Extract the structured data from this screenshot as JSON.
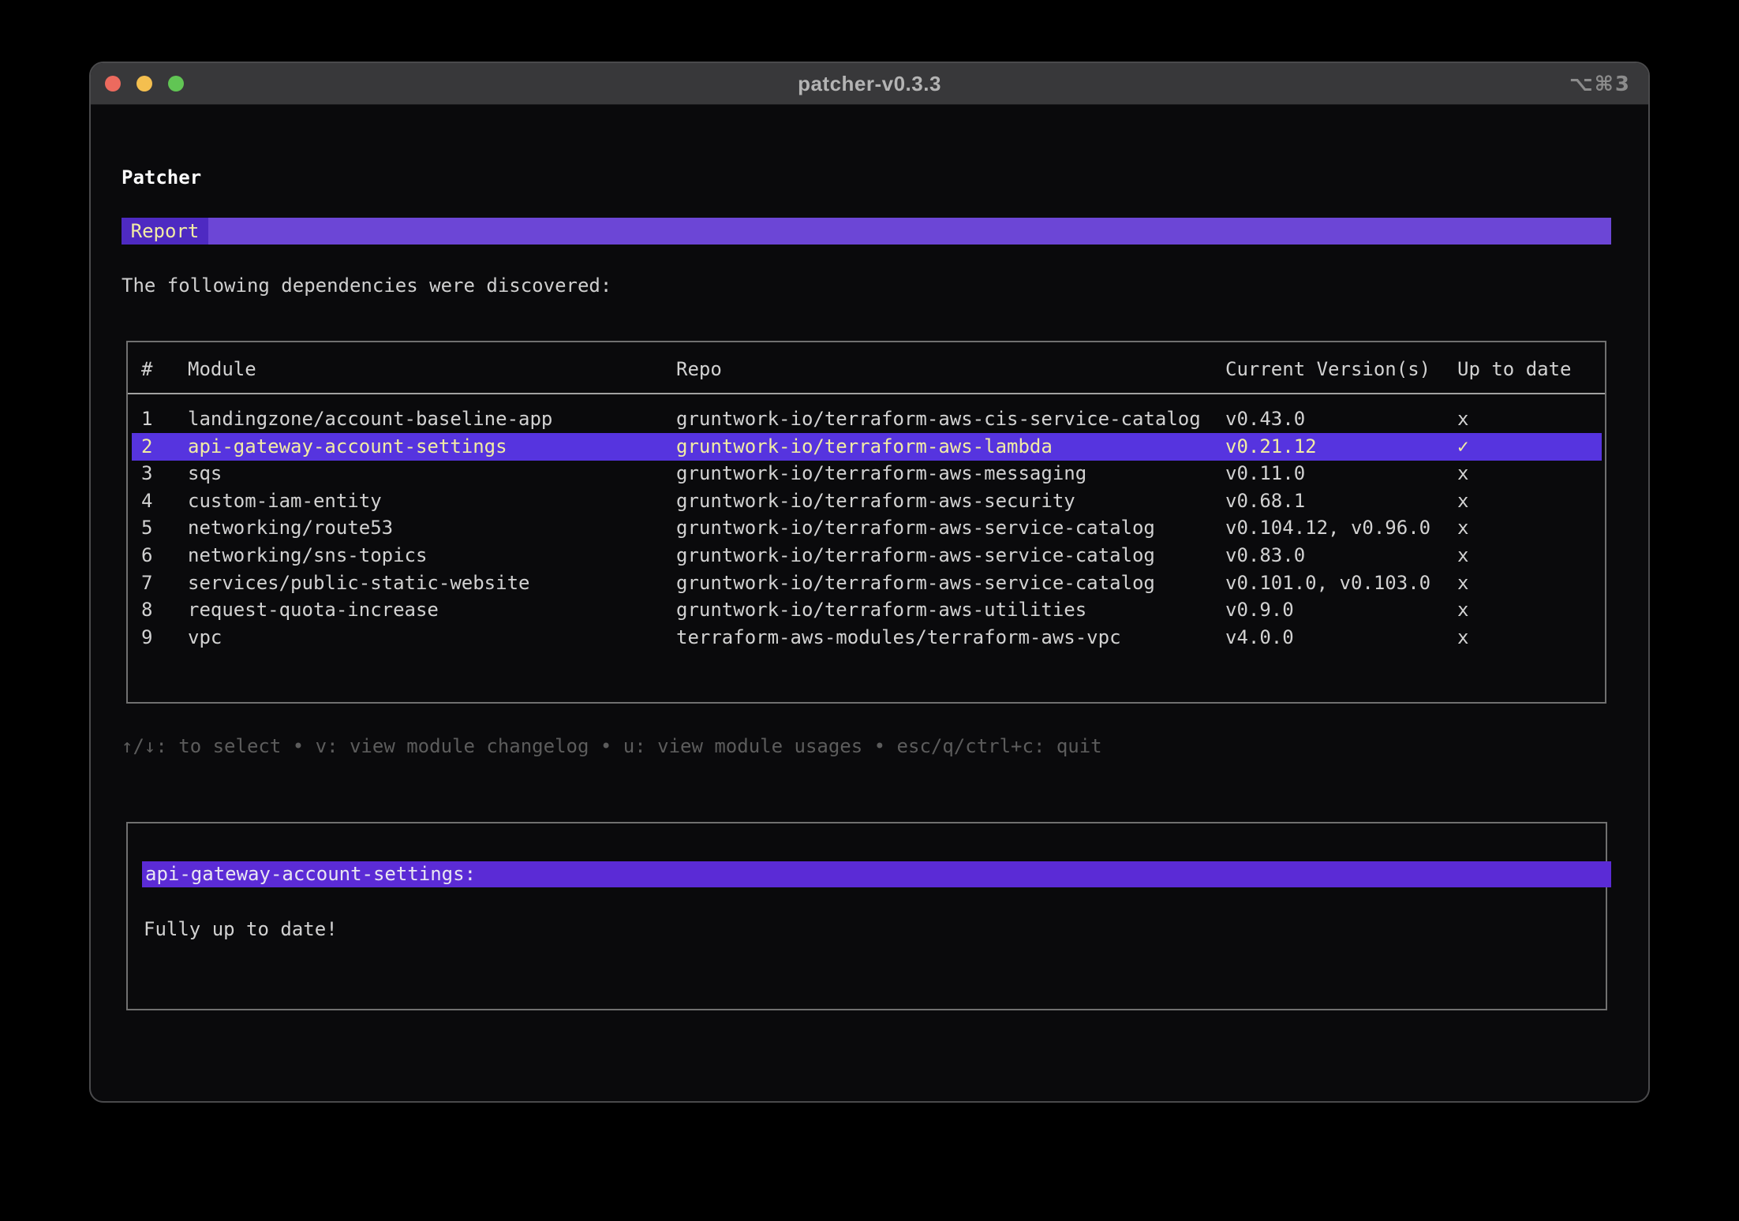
{
  "window": {
    "title": "patcher-v0.3.3",
    "shortcut": "⌥⌘3",
    "traffic_lights": [
      "close",
      "minimize",
      "zoom"
    ]
  },
  "app": {
    "heading": "Patcher",
    "tab_label": "Report",
    "intro": "The following dependencies were discovered:",
    "help": "↑/↓: to select • v: view module changelog • u: view module usages • esc/q/ctrl+c: quit",
    "table": {
      "headers": {
        "num": "#",
        "module": "Module",
        "repo": "Repo",
        "version": "Current Version(s)",
        "up_to_date": "Up to date"
      },
      "selected_index": 1,
      "rows": [
        {
          "num": "1",
          "module": "landingzone/account-baseline-app",
          "repo": "gruntwork-io/terraform-aws-cis-service-catalog",
          "version": "v0.43.0",
          "up_to_date": "x"
        },
        {
          "num": "2",
          "module": "api-gateway-account-settings",
          "repo": "gruntwork-io/terraform-aws-lambda",
          "version": "v0.21.12",
          "up_to_date": "✓"
        },
        {
          "num": "3",
          "module": "sqs",
          "repo": "gruntwork-io/terraform-aws-messaging",
          "version": "v0.11.0",
          "up_to_date": "x"
        },
        {
          "num": "4",
          "module": "custom-iam-entity",
          "repo": "gruntwork-io/terraform-aws-security",
          "version": "v0.68.1",
          "up_to_date": "x"
        },
        {
          "num": "5",
          "module": "networking/route53",
          "repo": "gruntwork-io/terraform-aws-service-catalog",
          "version": "v0.104.12, v0.96.0",
          "up_to_date": "x"
        },
        {
          "num": "6",
          "module": "networking/sns-topics",
          "repo": "gruntwork-io/terraform-aws-service-catalog",
          "version": "v0.83.0",
          "up_to_date": "x"
        },
        {
          "num": "7",
          "module": "services/public-static-website",
          "repo": "gruntwork-io/terraform-aws-service-catalog",
          "version": "v0.101.0, v0.103.0",
          "up_to_date": "x"
        },
        {
          "num": "8",
          "module": "request-quota-increase",
          "repo": "gruntwork-io/terraform-aws-utilities",
          "version": "v0.9.0",
          "up_to_date": "x"
        },
        {
          "num": "9",
          "module": "vpc",
          "repo": "terraform-aws-modules/terraform-aws-vpc",
          "version": "v4.0.0",
          "up_to_date": "x"
        }
      ]
    },
    "detail": {
      "title": "api-gateway-account-settings:",
      "body": "Fully up to date!"
    }
  },
  "colors": {
    "accent_bar": "#6c46d6",
    "accent_tab": "#4e2ac2",
    "accent_row": "#5634df",
    "accent_detail": "#5b2bd6",
    "text_selected": "#f2eca4",
    "text_main": "#d2d2d2",
    "text_dim": "#5c5c5c",
    "border_box": "#707070",
    "bg_titlebar": "#38383a",
    "traffic_red": "#ec6a5e",
    "traffic_yellow": "#f4bf4f",
    "traffic_green": "#61c554"
  }
}
